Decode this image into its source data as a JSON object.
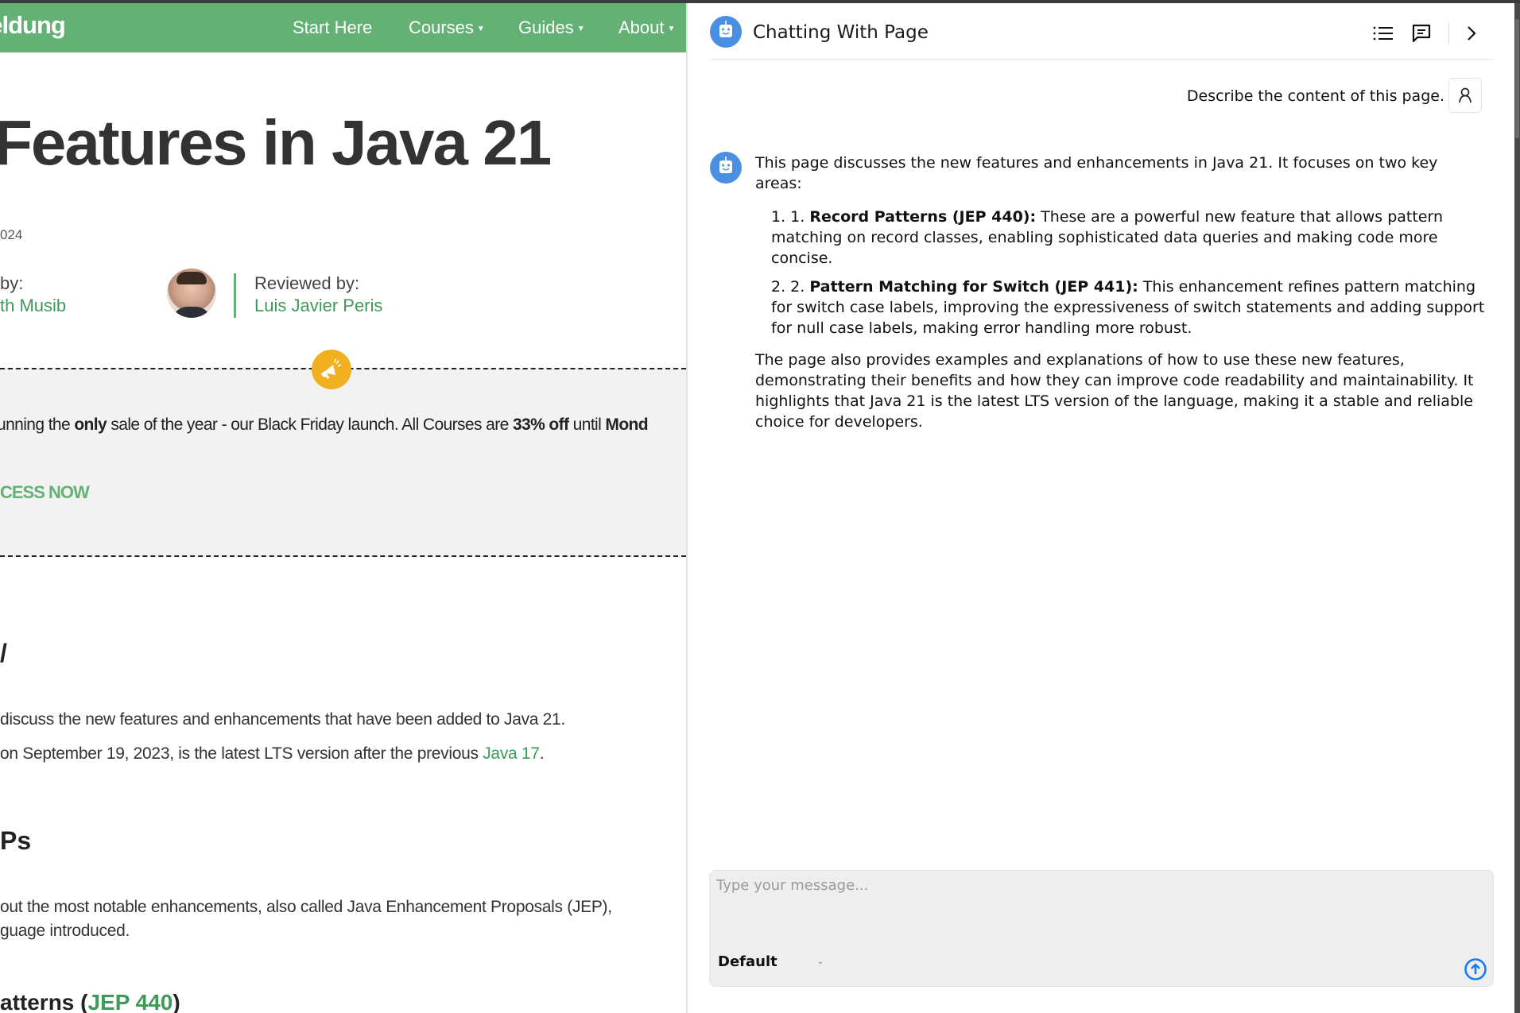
{
  "browser": {
    "theme_colors": {
      "site_green": "#63b175",
      "link_green": "#3f9a5a",
      "promo_yellow": "#f0b020",
      "chat_blue": "#4a90e2",
      "send_blue": "#1a7cf2"
    }
  },
  "website": {
    "logo_text": "aeldung",
    "nav": [
      {
        "label": "Start Here",
        "has_dropdown": false
      },
      {
        "label": "Courses",
        "has_dropdown": true
      },
      {
        "label": "Guides",
        "has_dropdown": true
      },
      {
        "label": "About",
        "has_dropdown": true
      }
    ],
    "article": {
      "title": "Features in Java 21",
      "date_fragment": "024",
      "author_label": "by:",
      "author_name": "th Musib",
      "reviewer_label": "Reviewed by:",
      "reviewer_name": "Luis Javier Peris"
    },
    "promo": {
      "text_pre": "unning the ",
      "text_bold1": "only",
      "text_mid": " sale of the year - our Black Friday launch. All Courses are ",
      "text_bold2": "33% off",
      "text_post": " until ",
      "text_bold3": "Mond",
      "cta": "CESS NOW"
    },
    "sections": {
      "overview_heading": "/",
      "overview_p1": "discuss the new features and enhancements that have been added to Java 21.",
      "overview_p2_pre": "on September 19, 2023, is the latest LTS version after the previous ",
      "overview_p2_link": "Java 17",
      "overview_p2_post": ".",
      "jeps_heading": "Ps",
      "jeps_p1": "out the most notable enhancements, also called Java Enhancement Proposals (JEP),",
      "jeps_p2": "guage introduced.",
      "record_heading_pre": "atterns (",
      "record_heading_link": "JEP 440",
      "record_heading_post": ")"
    }
  },
  "chat_panel": {
    "title": "Chatting With Page",
    "header_buttons": [
      "list-icon",
      "chat-bubble-icon",
      "chevron-right-icon"
    ],
    "messages": [
      {
        "role": "user",
        "text": "Describe the content of this page."
      },
      {
        "role": "assistant",
        "intro": "This page discusses the new features and enhancements in Java 21. It focuses on two key areas:",
        "items": [
          {
            "marker": "1. 1.",
            "title": "Record Patterns (JEP 440):",
            "text": " These are a powerful new feature that allows pattern matching on record classes, enabling sophisticated data queries and making code more concise."
          },
          {
            "marker": "2. 2.",
            "title": "Pattern Matching for Switch (JEP 441):",
            "text": " This enhancement refines pattern matching for switch case labels, improving the expressiveness of switch statements and adding support for null case labels, making error handling more robust."
          }
        ],
        "closing": "The page also provides examples and explanations of how to use these new features, demonstrating their benefits and how they can improve code readability and maintainability. It highlights that Java 21 is the latest LTS version of the language, making it a stable and reliable choice for developers."
      }
    ],
    "composer": {
      "placeholder": "Type your message...",
      "value": "",
      "mode_selected": "Default"
    }
  }
}
